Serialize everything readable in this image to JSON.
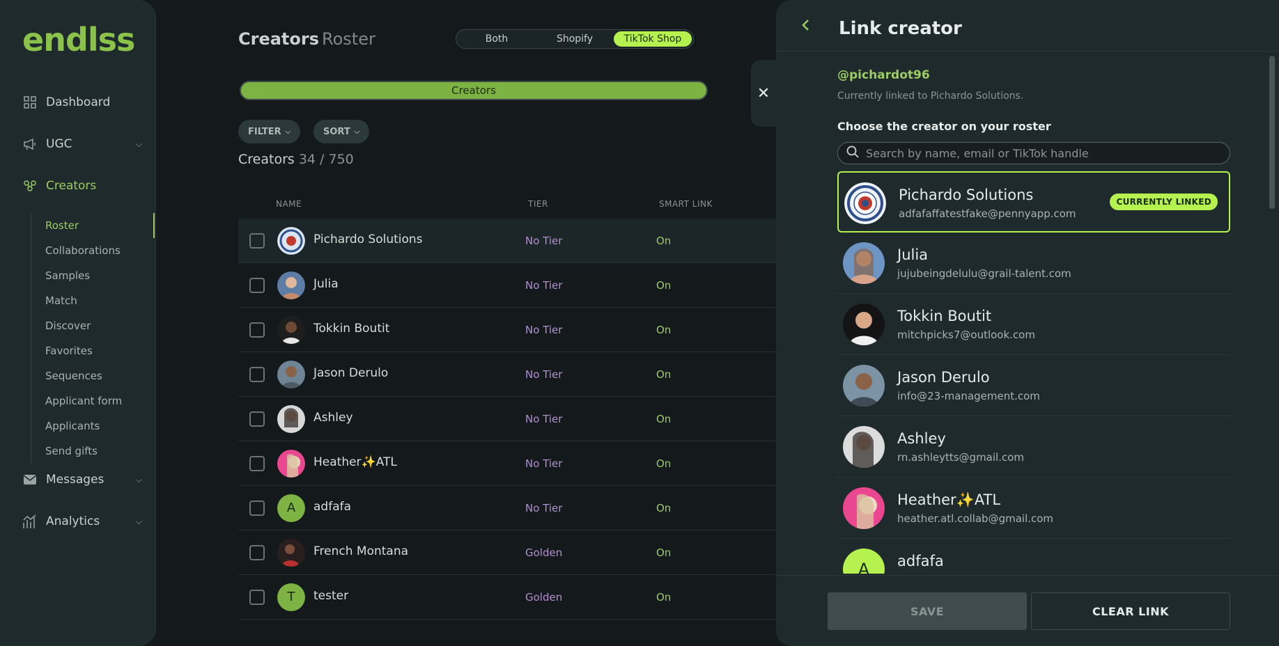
{
  "brand": {
    "logo": "endlss",
    "accent": "#b5f24f"
  },
  "sidebar": {
    "items": [
      {
        "label": "Dashboard",
        "icon": "grid-icon"
      },
      {
        "label": "UGC",
        "icon": "megaphone-icon"
      },
      {
        "label": "Creators",
        "icon": "people-icon"
      },
      {
        "label": "Messages",
        "icon": "mail-icon"
      },
      {
        "label": "Analytics",
        "icon": "chart-icon"
      }
    ],
    "subitems": [
      "Roster",
      "Collaborations",
      "Samples",
      "Match",
      "Discover",
      "Favorites",
      "Sequences",
      "Applicant form",
      "Applicants",
      "Send gifts"
    ]
  },
  "header": {
    "title": "Creators",
    "subtitle": "Roster",
    "segments": [
      "Both",
      "Shopify",
      "TikTok Shop"
    ],
    "active_segment": "TikTok Shop"
  },
  "progress": {
    "label": "Creators"
  },
  "toolbar": {
    "filter": "FILTER",
    "sort": "SORT"
  },
  "count": {
    "label": "Creators",
    "value": "34 / 750"
  },
  "table": {
    "columns": [
      "NAME",
      "TIER",
      "SMART LINK"
    ],
    "rows": [
      {
        "name": "Pichardo Solutions",
        "tier": "No Tier",
        "smart": "On"
      },
      {
        "name": "Julia",
        "tier": "No Tier",
        "smart": "On"
      },
      {
        "name": "Tokkin Boutit",
        "tier": "No Tier",
        "smart": "On"
      },
      {
        "name": "Jason Derulo",
        "tier": "No Tier",
        "smart": "On"
      },
      {
        "name": "Ashley",
        "tier": "No Tier",
        "smart": "On"
      },
      {
        "name": "Heather✨ATL",
        "tier": "No Tier",
        "smart": "On"
      },
      {
        "name": "adfafa",
        "tier": "No Tier",
        "smart": "On",
        "initial": "A"
      },
      {
        "name": "French Montana",
        "tier": "Golden",
        "smart": "On"
      },
      {
        "name": "tester",
        "tier": "Golden",
        "smart": "On",
        "initial": "T"
      }
    ]
  },
  "drawer": {
    "title": "Link creator",
    "handle": "@pichardot96",
    "linked_note": "Currently linked to Pichardo Solutions.",
    "choose_label": "Choose the creator on your roster",
    "search_placeholder": "Search by name, email or TikTok handle",
    "badge": "CURRENTLY LINKED",
    "creators": [
      {
        "name": "Pichardo Solutions",
        "email": "adfafaffatestfake@pennyapp.com"
      },
      {
        "name": "Julia",
        "email": "jujubeingdelulu@grail-talent.com"
      },
      {
        "name": "Tokkin Boutit",
        "email": "mitchpicks7@outlook.com"
      },
      {
        "name": "Jason Derulo",
        "email": "info@23-management.com"
      },
      {
        "name": "Ashley",
        "email": "rn.ashleytts@gmail.com"
      },
      {
        "name": "Heather✨ATL",
        "email": "heather.atl.collab@gmail.com"
      },
      {
        "name": "adfafa",
        "email": "",
        "initial": "A"
      }
    ],
    "save": "SAVE",
    "clear": "CLEAR LINK"
  }
}
